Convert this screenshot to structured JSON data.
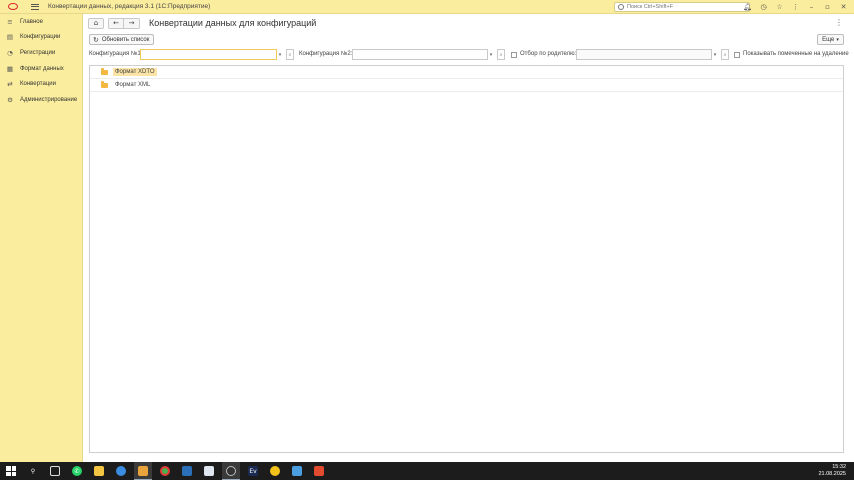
{
  "titlebar": {
    "title": "Конвертации данных, редакция 3.1  (1С:Предприятие)",
    "search_placeholder": "Поиск Ctrl+Shift+F"
  },
  "sidebar": {
    "items": [
      {
        "label": "Главное",
        "icon": "menu-icon"
      },
      {
        "label": "Конфигурации",
        "icon": "document-icon"
      },
      {
        "label": "Регистрации",
        "icon": "chart-icon"
      },
      {
        "label": "Формат данных",
        "icon": "table-icon"
      },
      {
        "label": "Конвертации",
        "icon": "exchange-icon"
      },
      {
        "label": "Администрирование",
        "icon": "gear-icon"
      }
    ]
  },
  "main": {
    "title": "Конвертации данных для конфигураций",
    "refresh_label": "Обновить список",
    "more_label": "Еще",
    "filters": {
      "config1_label": "Конфигурация №1:",
      "config1_value": "",
      "config2_label": "Конфигурация №2:",
      "config2_value": "",
      "parent_filter_label": "Отбор по родителю:",
      "parent_value": "",
      "show_deleted_label": "Показывать помеченные на удаление"
    },
    "tree": [
      {
        "label": "Формат XDTO",
        "selected": true
      },
      {
        "label": "Формат XML",
        "selected": false
      }
    ]
  },
  "taskbar": {
    "apps": [
      "whatsapp",
      "chrome",
      "files",
      "notepad",
      "1c",
      "telegram",
      "davinci",
      "photos"
    ],
    "time": "15:32",
    "date": "21.08.2025"
  }
}
